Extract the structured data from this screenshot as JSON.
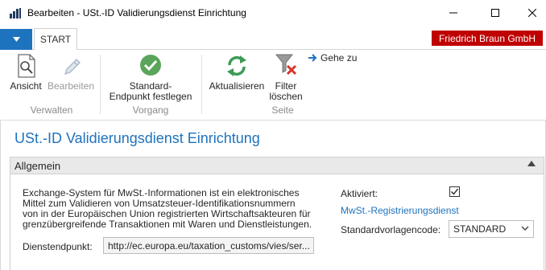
{
  "window": {
    "title": "Bearbeiten - USt.-ID Validierungsdienst Einrichtung"
  },
  "ribbon": {
    "tab_start": "START",
    "company": "Friedrich Braun GmbH",
    "buttons": {
      "ansicht": "Ansicht",
      "bearbeiten": "Bearbeiten",
      "standard_line1": "Standard-",
      "standard_line2": "Endpunkt festlegen",
      "aktualisieren": "Aktualisieren",
      "filter_line1": "Filter",
      "filter_line2": "löschen",
      "gehe_zu": "Gehe zu"
    },
    "groups": {
      "verwalten": "Verwalten",
      "vorgang": "Vorgang",
      "seite": "Seite"
    }
  },
  "page": {
    "title": "USt.-ID Validierungsdienst Einrichtung"
  },
  "fasttab": {
    "title": "Allgemein",
    "description_lines": [
      "Exchange-System für MwSt.-Informationen ist ein elektronisches",
      "Mittel zum Validieren von Umsatzsteuer-Identifikationsnummern",
      "von in der Europäischen Union registrierten Wirtschaftsakteuren für",
      "grenzübergreifende Transaktionen mit Waren und Dienstleistungen."
    ],
    "endpoint_label": "Dienstendpunkt:",
    "endpoint_value": "http://ec.europa.eu/taxation_customs/vies/ser...",
    "activated_label": "Aktiviert:",
    "activated_checked": true,
    "registration_link": "MwSt.-Registrierungsdienst",
    "template_label": "Standardvorlagencode:",
    "template_value": "STANDARD"
  },
  "colors": {
    "accent": "#1e73be",
    "company_badge": "#c00000",
    "check_green": "#5aa55a",
    "refresh_green": "#3e9a55",
    "delete_red": "#d9342b"
  },
  "icons": {
    "app": "chart-bars-icon",
    "menu": "chevron-down-icon",
    "ansicht": "document-search-icon",
    "bearbeiten": "pencil-icon",
    "standard": "checkmark-circle-icon",
    "aktualisieren": "refresh-icon",
    "filter": "filter-clear-icon",
    "gehe_zu": "arrow-right-icon"
  }
}
